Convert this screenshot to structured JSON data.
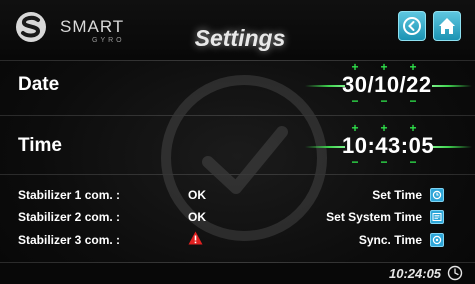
{
  "header": {
    "brand": "SMART",
    "brand_sub": "GYRO",
    "title": "Settings",
    "back_icon": "chevron-left-icon",
    "home_icon": "home-icon"
  },
  "date": {
    "label": "Date",
    "value": "30/10/22"
  },
  "time": {
    "label": "Time",
    "value": "10:43:05"
  },
  "stabilizers": [
    {
      "label": "Stabilizer 1 com. :",
      "status": "OK"
    },
    {
      "label": "Stabilizer 2  com. :",
      "status": "OK"
    },
    {
      "label": "Stabilizer 3  com. :",
      "status": "",
      "status_icon": "warning-icon"
    }
  ],
  "actions": [
    {
      "label": "Set Time",
      "icon": "set-time-icon"
    },
    {
      "label": "Set System Time",
      "icon": "system-time-icon"
    },
    {
      "label": "Sync. Time",
      "icon": "sync-time-icon"
    }
  ],
  "footer": {
    "time": "10:24:05",
    "icon": "clock-icon"
  },
  "colors": {
    "accent": "#2ea6d8",
    "plus_minus": "#2ee04a",
    "warning": "#e02020",
    "background": "#0c0c0c"
  }
}
